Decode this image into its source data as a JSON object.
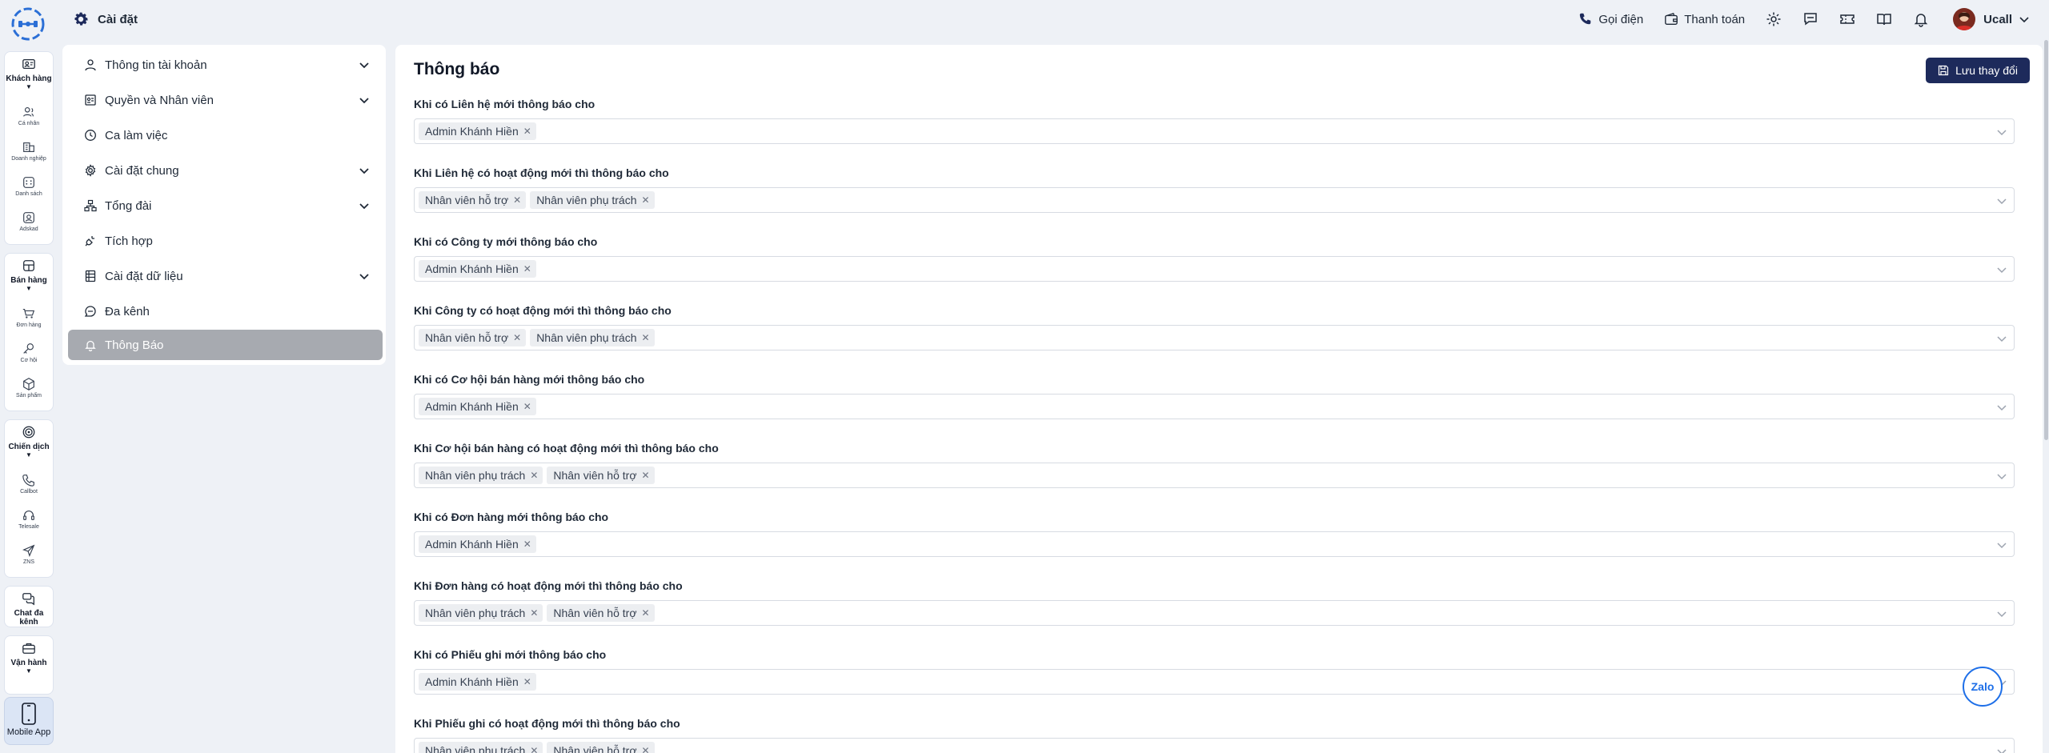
{
  "window": {
    "page_title": "Cài đặt"
  },
  "rail": {
    "groups": [
      {
        "label": "Khách hàng",
        "items": [
          "Cá nhân",
          "Doanh nghiệp",
          "Danh sách",
          "Adskad"
        ]
      },
      {
        "label": "Bán hàng",
        "items": [
          "Đơn hàng",
          "Cơ hội",
          "Sản phẩm"
        ]
      },
      {
        "label": "Chiến dịch",
        "items": [
          "Callbot",
          "Telesale",
          "ZNS"
        ]
      },
      {
        "label": "Chat đa kênh",
        "items": []
      },
      {
        "label": "Vận hành",
        "items": []
      }
    ],
    "mobile_app": "Mobile App"
  },
  "topbar": {
    "call": "Gọi điện",
    "payment": "Thanh toán",
    "user": "Ucall"
  },
  "menu": {
    "items": [
      {
        "label": "Thông tin tài khoản",
        "icon": "user-icon",
        "expandable": true
      },
      {
        "label": "Quyền và Nhân viên",
        "icon": "id-card-icon",
        "expandable": true
      },
      {
        "label": "Ca làm việc",
        "icon": "clock-icon",
        "expandable": false
      },
      {
        "label": "Cài đặt chung",
        "icon": "gear-icon",
        "expandable": true
      },
      {
        "label": "Tổng đài",
        "icon": "network-icon",
        "expandable": true
      },
      {
        "label": "Tích hợp",
        "icon": "plug-icon",
        "expandable": false
      },
      {
        "label": "Cài đặt dữ liệu",
        "icon": "database-icon",
        "expandable": true
      },
      {
        "label": "Đa kênh",
        "icon": "chat-icon",
        "expandable": false
      },
      {
        "label": "Thông Báo",
        "icon": "bell-icon",
        "expandable": false,
        "active": true
      }
    ]
  },
  "main": {
    "title": "Thông báo",
    "save_label": "Lưu thay đổi",
    "fields": [
      {
        "label": "Khi có Liên hệ mới thông báo cho",
        "tags": [
          "Admin Khánh Hiền"
        ]
      },
      {
        "label": "Khi Liên hệ có hoạt động mới thì thông báo cho",
        "tags": [
          "Nhân viên hỗ trợ",
          "Nhân viên phụ trách"
        ]
      },
      {
        "label": "Khi có Công ty mới thông báo cho",
        "tags": [
          "Admin Khánh Hiền"
        ]
      },
      {
        "label": "Khi Công ty có hoạt động mới thì thông báo cho",
        "tags": [
          "Nhân viên hỗ trợ",
          "Nhân viên phụ trách"
        ]
      },
      {
        "label": "Khi có Cơ hội bán hàng mới thông báo cho",
        "tags": [
          "Admin Khánh Hiền"
        ]
      },
      {
        "label": "Khi Cơ hội bán hàng có hoạt động mới thì thông báo cho",
        "tags": [
          "Nhân viên phụ trách",
          "Nhân viên hỗ trợ"
        ]
      },
      {
        "label": "Khi có Đơn hàng mới thông báo cho",
        "tags": [
          "Admin Khánh Hiền"
        ]
      },
      {
        "label": "Khi Đơn hàng có hoạt động mới thì thông báo cho",
        "tags": [
          "Nhân viên phụ trách",
          "Nhân viên hỗ trợ"
        ]
      },
      {
        "label": "Khi có Phiếu ghi mới thông báo cho",
        "tags": [
          "Admin Khánh Hiền"
        ]
      },
      {
        "label": "Khi Phiếu ghi có hoạt động mới thì thông báo cho",
        "tags": [
          "Nhân viên phụ trách",
          "Nhân viên hỗ trợ"
        ]
      }
    ]
  },
  "widget": {
    "zalo": "Zalo"
  },
  "colors": {
    "primary": "#1d2a5b",
    "active_menu": "#a7aab0",
    "zalo": "#1e6fe8"
  }
}
